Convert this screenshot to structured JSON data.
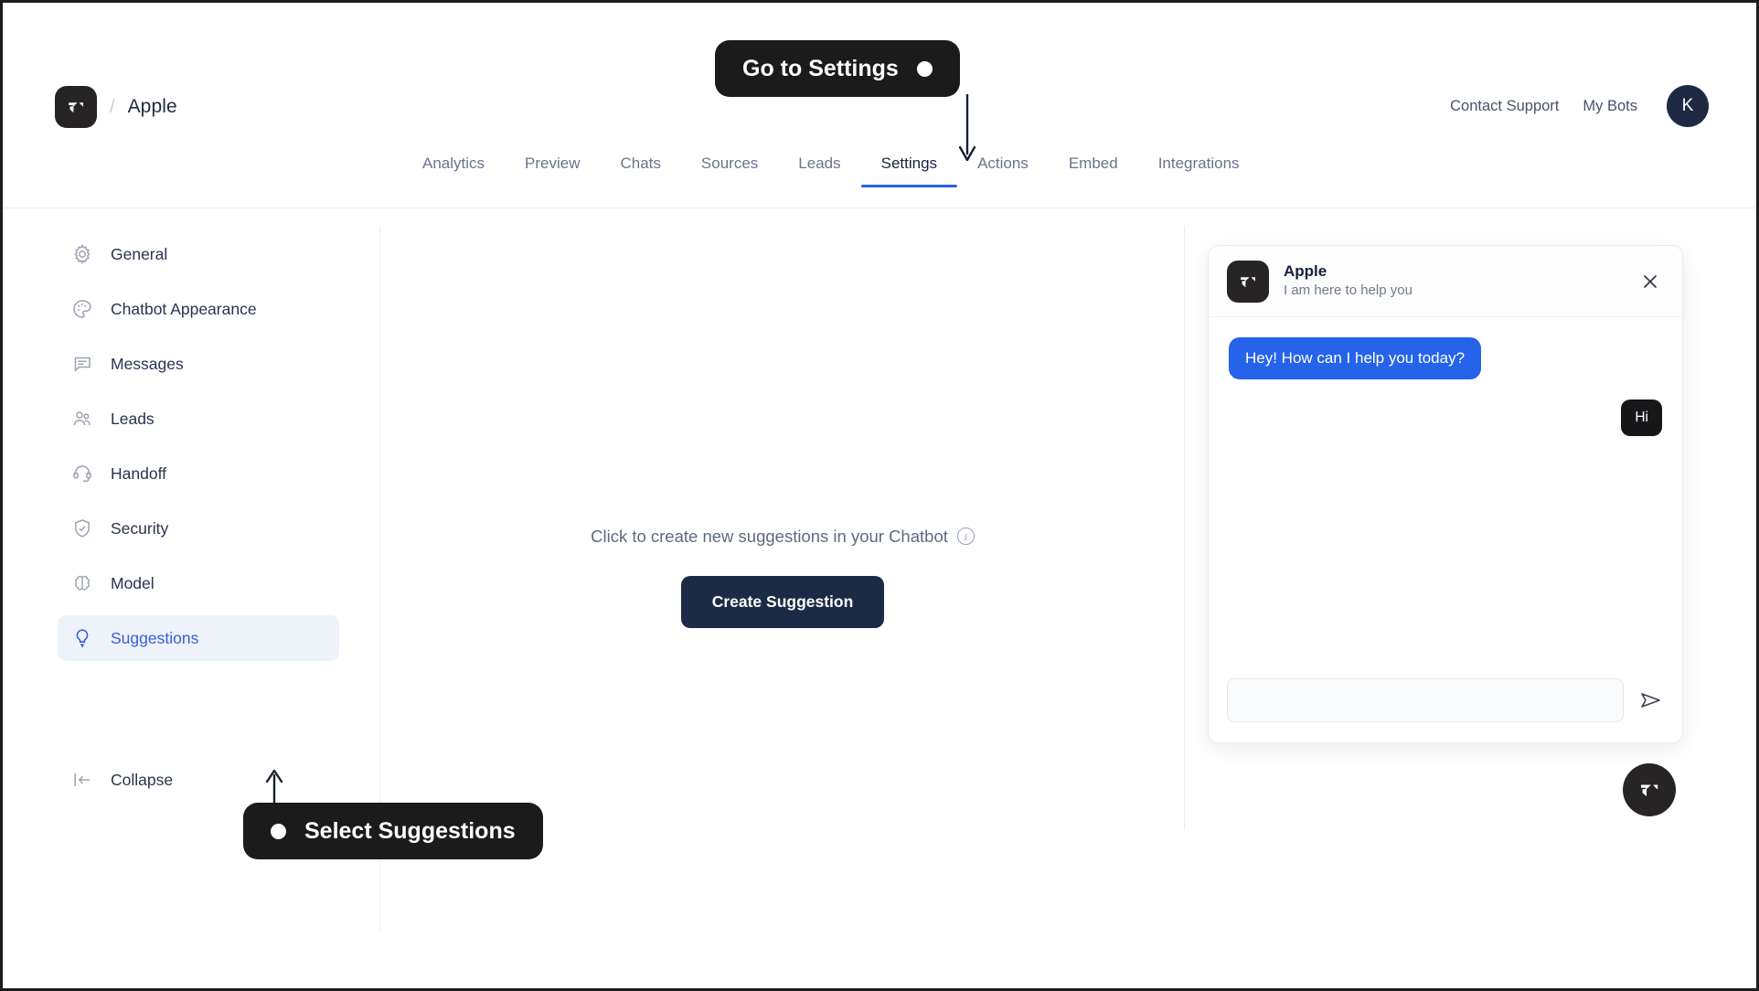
{
  "brand": {
    "logo_icon": "chatbot-logo-icon",
    "separator": "/",
    "name": "Apple"
  },
  "header": {
    "contact_support": "Contact Support",
    "my_bots": "My Bots",
    "avatar_initial": "K"
  },
  "tabs": [
    {
      "label": "Analytics",
      "active": false
    },
    {
      "label": "Preview",
      "active": false
    },
    {
      "label": "Chats",
      "active": false
    },
    {
      "label": "Sources",
      "active": false
    },
    {
      "label": "Leads",
      "active": false
    },
    {
      "label": "Settings",
      "active": true
    },
    {
      "label": "Actions",
      "active": false
    },
    {
      "label": "Embed",
      "active": false
    },
    {
      "label": "Integrations",
      "active": false
    }
  ],
  "sidebar": {
    "items": [
      {
        "label": "General",
        "icon": "gear-icon",
        "active": false
      },
      {
        "label": "Chatbot Appearance",
        "icon": "palette-icon",
        "active": false
      },
      {
        "label": "Messages",
        "icon": "message-icon",
        "active": false
      },
      {
        "label": "Leads",
        "icon": "users-icon",
        "active": false
      },
      {
        "label": "Handoff",
        "icon": "headset-icon",
        "active": false
      },
      {
        "label": "Security",
        "icon": "shield-check-icon",
        "active": false
      },
      {
        "label": "Model",
        "icon": "brain-icon",
        "active": false
      },
      {
        "label": "Suggestions",
        "icon": "lightbulb-icon",
        "active": true
      }
    ],
    "collapse": {
      "label": "Collapse",
      "icon": "collapse-icon"
    }
  },
  "main": {
    "empty_message": "Click to create new suggestions in your Chatbot",
    "info_icon": "info-icon",
    "create_button": "Create Suggestion"
  },
  "chat_widget": {
    "title": "Apple",
    "subtitle": "I am here to help you",
    "close_icon": "close-icon",
    "messages": [
      {
        "sender": "bot",
        "text": "Hey! How can I help you today?"
      },
      {
        "sender": "user",
        "text": "Hi"
      }
    ],
    "input_placeholder": "",
    "input_value": "",
    "send_icon": "send-icon",
    "launcher_icon": "chatbot-logo-icon"
  },
  "callouts": [
    {
      "id": "settings",
      "text": "Go to Settings",
      "dot_position": "right"
    },
    {
      "id": "suggestions",
      "text": "Select Suggestions",
      "dot_position": "left"
    }
  ],
  "colors": {
    "accent_blue": "#2563eb",
    "sidebar_active_bg": "#eef2f9",
    "sidebar_active_text": "#3b5bdb",
    "dark_navy": "#1c2b45",
    "callout_bg": "#1b1b1b",
    "logo_bg": "#272425"
  }
}
